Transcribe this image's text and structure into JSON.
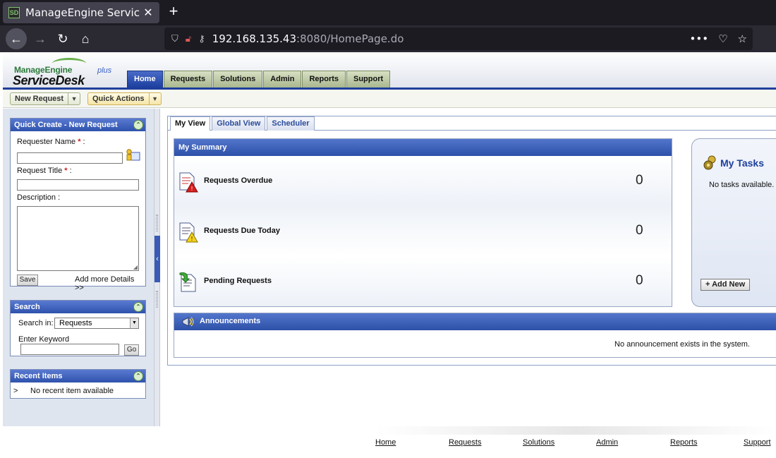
{
  "browser": {
    "tab_title": "ManageEngine ServiceDe",
    "favicon_text": "SD",
    "url_host": "192.168.135.43",
    "url_rest": ":8080/HomePage.do"
  },
  "app": {
    "brand_top": "ManageEngine",
    "brand_main": "ServiceDesk",
    "brand_plus": "plus"
  },
  "main_tabs": [
    {
      "label": "Home",
      "active": true
    },
    {
      "label": "Requests"
    },
    {
      "label": "Solutions"
    },
    {
      "label": "Admin"
    },
    {
      "label": "Reports"
    },
    {
      "label": "Support"
    }
  ],
  "toolbar": {
    "new_request": "New Request",
    "quick_actions": "Quick Actions"
  },
  "quick_create": {
    "title": "Quick Create - New Request",
    "requester_label": "Requester Name",
    "title_label": "Request Title",
    "required_mark": "*",
    "colon": " :",
    "description_label": "Description :",
    "save": "Save",
    "more_details": "Add more Details >>"
  },
  "search": {
    "title": "Search",
    "search_in_label": "Search in:",
    "search_in_value": "Requests",
    "keyword_label": "Enter Keyword",
    "go": "Go"
  },
  "recent": {
    "title": "Recent Items",
    "bullet": ">",
    "empty": "No recent item available"
  },
  "content_tabs": [
    {
      "label": "My View",
      "active": true
    },
    {
      "label": "Global View"
    },
    {
      "label": "Scheduler"
    }
  ],
  "summary": {
    "title": "My Summary",
    "rows": [
      {
        "name": "Requests Overdue",
        "value": "0"
      },
      {
        "name": "Requests Due Today",
        "value": "0"
      },
      {
        "name": "Pending Requests",
        "value": "0"
      }
    ]
  },
  "tasks": {
    "title": "My Tasks",
    "empty": "No tasks available.",
    "add_new": "+ Add New"
  },
  "announcements": {
    "title": "Announcements",
    "empty": "No announcement exists in the system."
  },
  "footer": [
    "Home",
    "Requests",
    "Solutions",
    "Admin",
    "Reports",
    "Support"
  ]
}
